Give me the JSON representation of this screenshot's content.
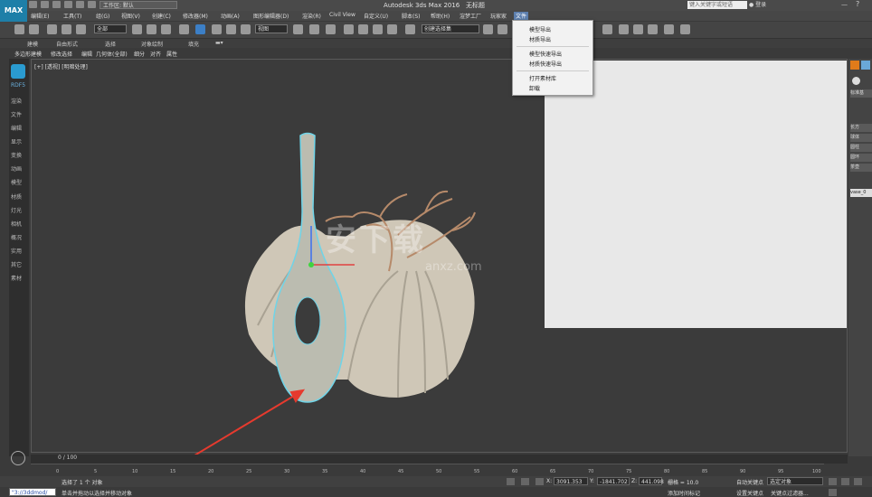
{
  "app": {
    "title": "Autodesk 3ds Max 2016",
    "document": "无标题",
    "workspace_label": "工作区: 默认",
    "search_placeholder": "键入关键字或短语",
    "login_label": "登录",
    "logo_text": "MAX"
  },
  "menubar": {
    "items": [
      "编辑(E)",
      "工具(T)",
      "组(G)",
      "视图(V)",
      "创建(C)",
      "修改器(M)",
      "动画(A)",
      "图形编辑器(D)",
      "渲染(R)",
      "Civil View",
      "自定义(U)",
      "脚本(S)",
      "帮助(H)",
      "渲梦工厂",
      "玩家家",
      "文件"
    ],
    "active_item": "文件"
  },
  "toolbar": {
    "filter_select": "全部",
    "view_select": "视图",
    "selection_set": "创建选择集"
  },
  "ribbon": {
    "tabs": [
      "建模",
      "自由形式",
      "选择",
      "对象绘制",
      "填充"
    ],
    "subtabs": [
      "多边形建模",
      "修改选择",
      "编辑",
      "几何体(全部)",
      "细分",
      "对齐",
      "属性"
    ]
  },
  "command_panel": {
    "items": [
      "RDF5",
      "渲染",
      "文件",
      "编辑",
      "显示",
      "变换",
      "动画",
      "模型",
      "材质",
      "灯光",
      "相机",
      "概况",
      "实用",
      "其它",
      "素材"
    ]
  },
  "viewport": {
    "label": "[+] [透视] [明暗处理]",
    "watermark": "安下载",
    "watermark_sub": "anxz.com"
  },
  "dropdown": {
    "items": [
      "模型导出",
      "材质导出",
      "模型快速导出",
      "材质快速导出",
      "打开素材库",
      "卸载"
    ]
  },
  "right_panel": {
    "items": [
      "标准基",
      "长方",
      "球体",
      "圆柱",
      "圆环",
      "茶壶",
      "vase_0"
    ]
  },
  "timeline": {
    "frame_label": "0 / 100",
    "ticks": [
      "0",
      "5",
      "10",
      "15",
      "20",
      "25",
      "30",
      "35",
      "40",
      "45",
      "50",
      "55",
      "60",
      "65",
      "70",
      "75",
      "80",
      "85",
      "90",
      "95",
      "100"
    ]
  },
  "status": {
    "selected": "选择了 1 个 对象",
    "hint": "单击并拖动以选择并移动对象",
    "script_field": "\"3://3ddmod/",
    "x_label": "X:",
    "x_value": "3091.353",
    "y_label": "Y:",
    "y_value": "-1841.702",
    "z_label": "Z:",
    "z_value": "441.098",
    "grid_label": "栅格 = 10.0",
    "add_time_tag": "添加时间标记",
    "auto_key": "自动关键点",
    "set_key": "设置关键点",
    "selected_object": "选定对象",
    "key_filters": "关键点过滤器..."
  }
}
